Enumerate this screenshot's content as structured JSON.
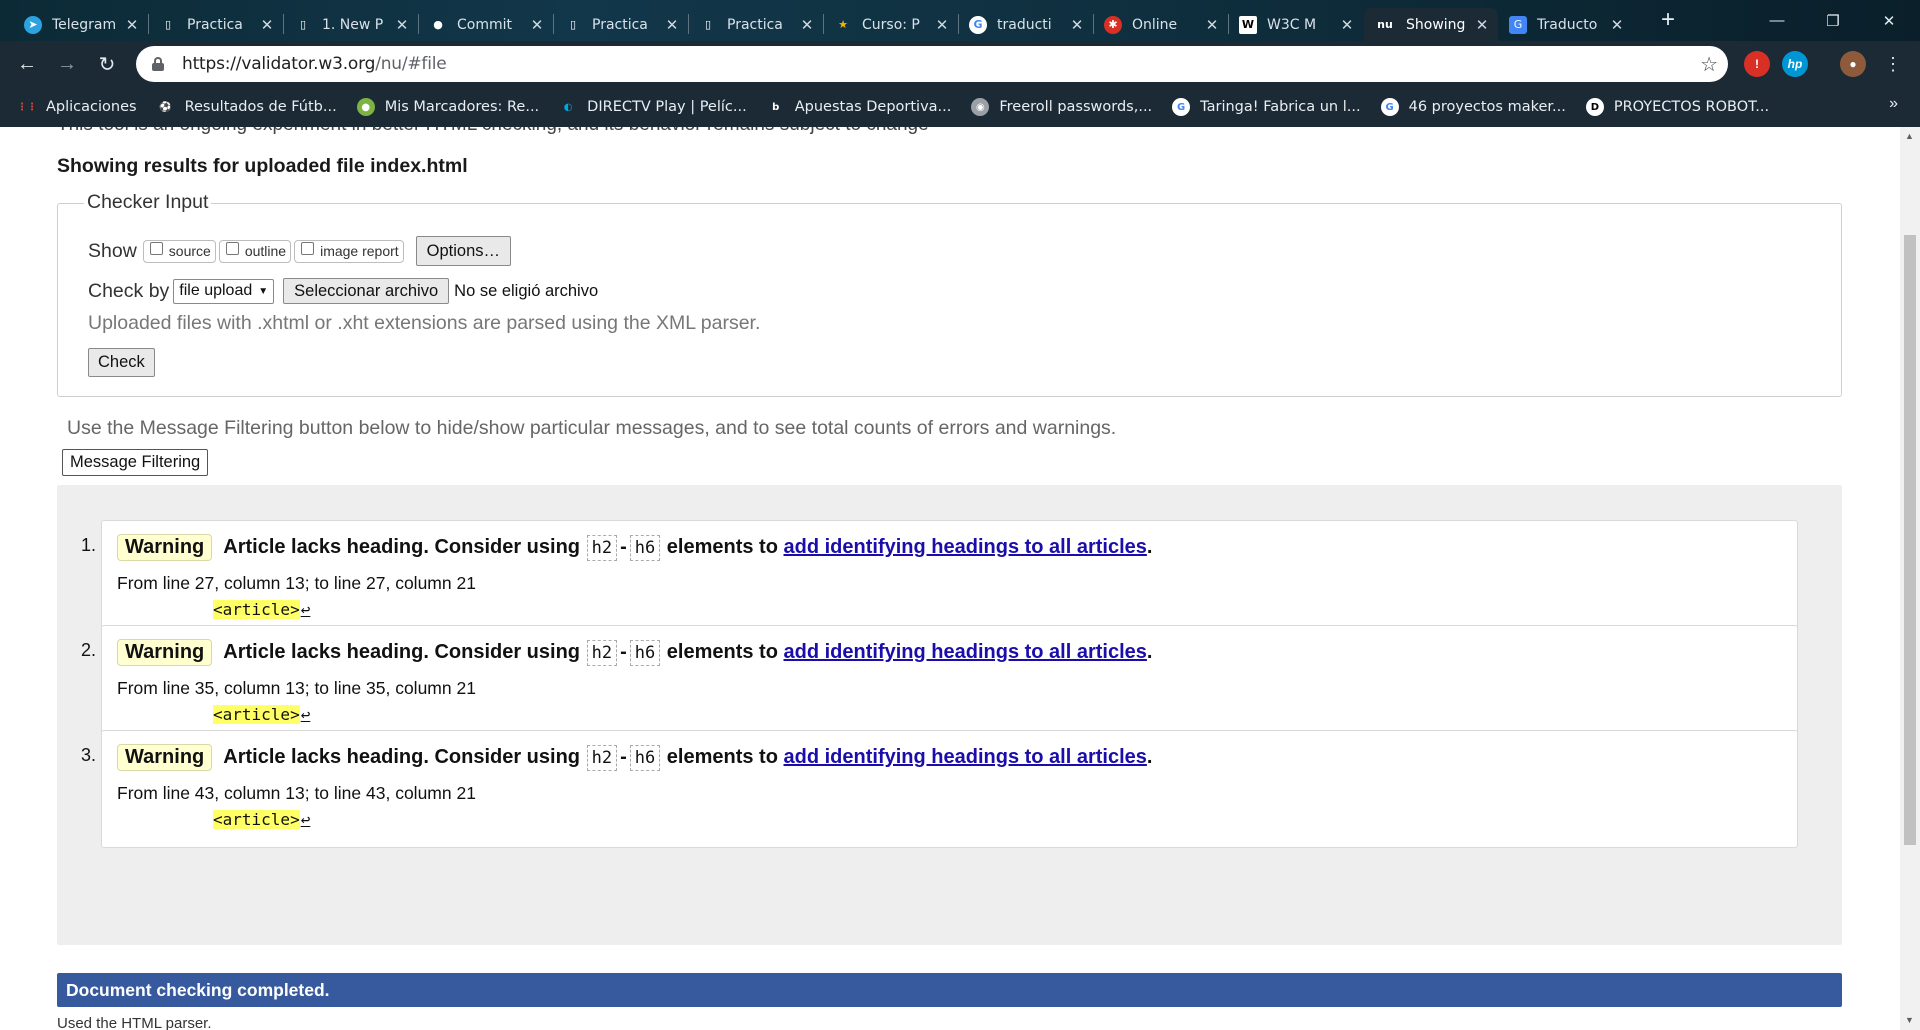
{
  "browser": {
    "tabs": [
      {
        "title": "Telegram",
        "icon": "telegram-icon",
        "color": "#2aa3e0",
        "active": false
      },
      {
        "title": "Practica",
        "icon": "document-icon",
        "color": "#ffffff",
        "active": false
      },
      {
        "title": "1. New P",
        "icon": "document-icon",
        "color": "#ffffff",
        "active": false
      },
      {
        "title": "Commit",
        "icon": "github-icon",
        "color": "#ffffff",
        "active": false
      },
      {
        "title": "Practica",
        "icon": "document-icon",
        "color": "#ffffff",
        "active": false
      },
      {
        "title": "Practica",
        "icon": "document-icon",
        "color": "#ffffff",
        "active": false
      },
      {
        "title": "Curso: P",
        "icon": "course-icon",
        "color": "#f4b400",
        "active": false
      },
      {
        "title": "traducti",
        "icon": "google-icon",
        "color": "#ffffff",
        "active": false
      },
      {
        "title": "Online",
        "icon": "online-icon",
        "color": "#d93025",
        "active": false
      },
      {
        "title": "W3C M",
        "icon": "wikipedia-icon",
        "color": "#ffffff",
        "active": false
      },
      {
        "title": "Showing",
        "icon": "nu-icon",
        "color": "#ffffff",
        "active": true
      },
      {
        "title": "Traducto",
        "icon": "translate-icon",
        "color": "#4285f4",
        "active": false
      }
    ],
    "url_host": "https://validator.w3.org",
    "url_path": "/nu/#file",
    "bookmarks": [
      {
        "label": "Aplicaciones",
        "icon": "apps-grid-icon",
        "color": "#ea4335"
      },
      {
        "label": "Resultados de Fútb...",
        "icon": "soccer-icon",
        "color": "#34a853"
      },
      {
        "label": "Mis Marcadores: Re...",
        "icon": "marcadores-icon",
        "color": "#7cb342"
      },
      {
        "label": "DIRECTV Play | Pelíc...",
        "icon": "directv-icon",
        "color": "#00a8e1"
      },
      {
        "label": "Apuestas Deportiva...",
        "icon": "bet-icon",
        "color": "#ffffff"
      },
      {
        "label": "Freeroll passwords,...",
        "icon": "poker-icon",
        "color": "#9aa0a6"
      },
      {
        "label": "Taringa! Fabrica un l...",
        "icon": "google-icon",
        "color": "#ffffff"
      },
      {
        "label": "46 proyectos maker...",
        "icon": "google-icon",
        "color": "#ffffff"
      },
      {
        "label": "PROYECTOS ROBOT...",
        "icon": "robot-icon",
        "color": "#ffffff"
      }
    ]
  },
  "page": {
    "cut_text": "This tool is an ongoing experiment in better HTML checking, and its behavior remains subject to change",
    "results_heading": "Showing results for uploaded file index.html",
    "checker": {
      "legend": "Checker Input",
      "show_label": "Show",
      "show_options": [
        "source",
        "outline",
        "image report"
      ],
      "options_button": "Options…",
      "check_by_label": "Check by",
      "check_by_value": "file upload",
      "file_button": "Seleccionar archivo",
      "file_status": "No se eligió archivo",
      "hint": "Uploaded files with .xhtml or .xht extensions are parsed using the XML parser.",
      "check_button": "Check"
    },
    "filter_note": "Use the Message Filtering button below to hide/show particular messages, and to see total counts of errors and warnings.",
    "filter_button": "Message Filtering",
    "messages": [
      {
        "num": "1.",
        "type": "Warning",
        "text_before": "Article lacks heading. Consider using",
        "code1": "h2",
        "sep": "-",
        "code2": "h6",
        "text_mid": "elements to",
        "link": "add identifying headings to all articles",
        "end": ".",
        "location": "From line 27, column 13; to line 27, column 21",
        "extract": "<article>",
        "ret": "↩"
      },
      {
        "num": "2.",
        "type": "Warning",
        "text_before": "Article lacks heading. Consider using",
        "code1": "h2",
        "sep": "-",
        "code2": "h6",
        "text_mid": "elements to",
        "link": "add identifying headings to all articles",
        "end": ".",
        "location": "From line 35, column 13; to line 35, column 21",
        "extract": "<article>",
        "ret": "↩"
      },
      {
        "num": "3.",
        "type": "Warning",
        "text_before": "Article lacks heading. Consider using",
        "code1": "h2",
        "sep": "-",
        "code2": "h6",
        "text_mid": "elements to",
        "link": "add identifying headings to all articles",
        "end": ".",
        "location": "From line 43, column 13; to line 43, column 21",
        "extract": "<article>",
        "ret": "↩"
      }
    ],
    "done_text": "Document checking completed.",
    "parser_text": "Used the HTML parser."
  },
  "colors": {
    "done_bar": "#375a9e",
    "warning_badge": "#ffffd0",
    "extract_highlight": "#ffff66",
    "link": "#1a0dab"
  }
}
